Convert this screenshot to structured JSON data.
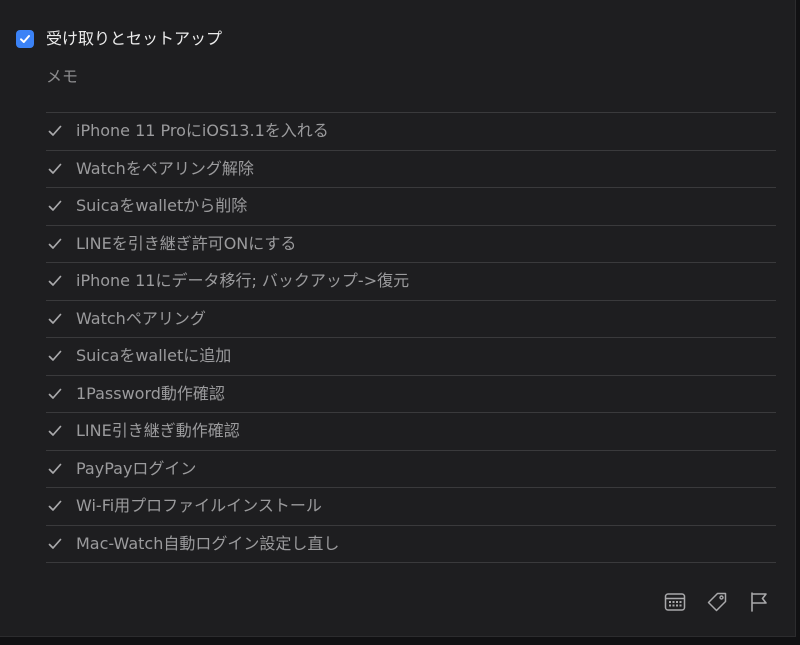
{
  "task": {
    "title": "受け取りとセットアップ",
    "completed": true,
    "memo": "メモ"
  },
  "subtasks": [
    {
      "label": "iPhone 11 ProにiOS13.1を入れる",
      "done": true
    },
    {
      "label": "Watchをペアリング解除",
      "done": true
    },
    {
      "label": "Suicaをwalletから削除",
      "done": true
    },
    {
      "label": "LINEを引き継ぎ許可ONにする",
      "done": true
    },
    {
      "label": "iPhone 11にデータ移行; バックアップ->復元",
      "done": true
    },
    {
      "label": "Watchペアリング",
      "done": true
    },
    {
      "label": "Suicaをwalletに追加",
      "done": true
    },
    {
      "label": "1Password動作確認",
      "done": true
    },
    {
      "label": "LINE引き継ぎ動作確認",
      "done": true
    },
    {
      "label": "PayPayログイン",
      "done": true
    },
    {
      "label": "Wi-Fi用プロファイルインストール",
      "done": true
    },
    {
      "label": "Mac-Watch自動ログイン設定し直し",
      "done": true
    }
  ],
  "toolbar": {
    "icons": [
      "calendar-icon",
      "tag-icon",
      "flag-icon"
    ]
  },
  "colors": {
    "accent": "#3b82f6",
    "background": "#1e1e20",
    "divider": "#3a3a3c",
    "title_text": "#ececec",
    "subtask_text": "#9b9b9d"
  }
}
